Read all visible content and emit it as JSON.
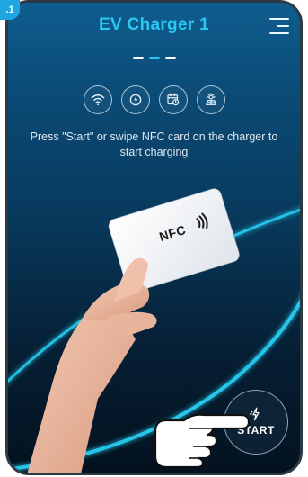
{
  "badge": ".1",
  "header": {
    "title": "EV Charger 1"
  },
  "status_icons": [
    "wifi-icon",
    "plug-charge-icon",
    "calendar-clock-icon",
    "solar-sun-icon"
  ],
  "instruction": "Press \"Start\" or swipe NFC card on the charger to start charging",
  "nfc_card": {
    "label": "NFC"
  },
  "start_button": {
    "label": "START"
  },
  "colors": {
    "accent": "#29c8f2",
    "background_top": "#0f5d8f",
    "background_bottom": "#04121f"
  }
}
